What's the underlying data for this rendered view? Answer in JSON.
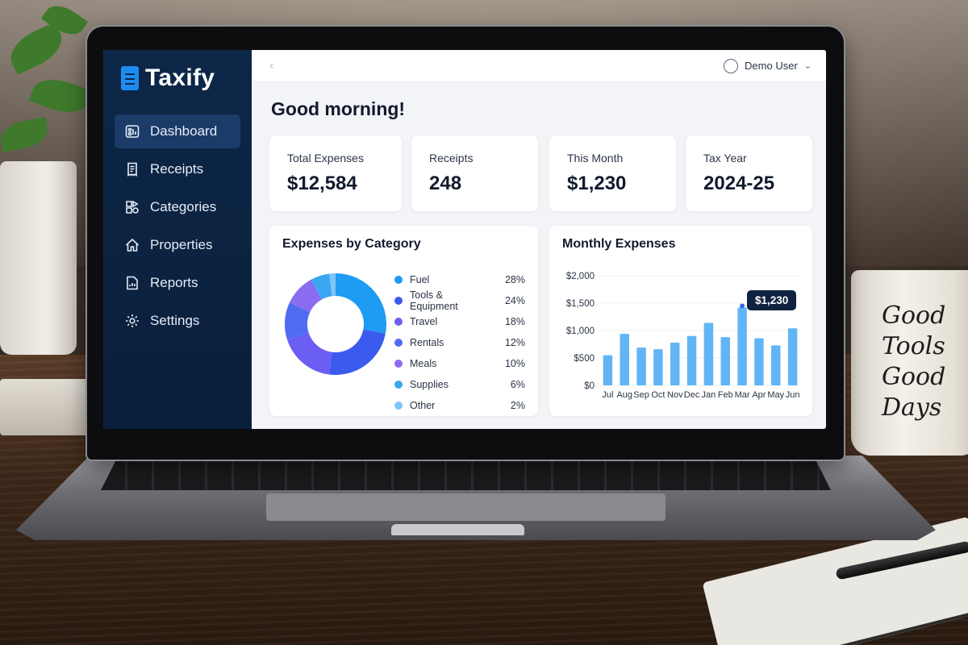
{
  "app": {
    "name": "Taxify"
  },
  "sidebar": {
    "items": [
      {
        "label": "Dashboard",
        "icon": "dashboard-icon",
        "active": true
      },
      {
        "label": "Receipts",
        "icon": "receipt-icon",
        "active": false
      },
      {
        "label": "Categories",
        "icon": "categories-icon",
        "active": false
      },
      {
        "label": "Properties",
        "icon": "home-icon",
        "active": false
      },
      {
        "label": "Reports",
        "icon": "report-icon",
        "active": false
      },
      {
        "label": "Settings",
        "icon": "gear-icon",
        "active": false
      }
    ]
  },
  "topbar": {
    "back_icon": "chevron-left-icon",
    "user_name": "Demo User",
    "user_icon": "user-icon",
    "dropdown_icon": "chevron-down-icon"
  },
  "main": {
    "greeting": "Good morning!",
    "stats": [
      {
        "label": "Total Expenses",
        "value": "$12,584"
      },
      {
        "label": "Receipts",
        "value": "248"
      },
      {
        "label": "This Month",
        "value": "$1,230"
      },
      {
        "label": "Tax Year",
        "value": "2024-25"
      }
    ]
  },
  "mug": {
    "text_lines": [
      "Good",
      "Tools",
      "Good",
      "Days"
    ]
  },
  "colors": {
    "sidebar_bg": "#0d2748",
    "sidebar_active": "#1b3c69",
    "brand_blue": "#1d8cf0",
    "bar_blue": "#62b5f5",
    "tooltip_bg": "#0f2240"
  },
  "chart_data": [
    {
      "type": "pie",
      "title": "Expenses by Category",
      "categories": [
        "Fuel",
        "Tools & Equipment",
        "Travel",
        "Rentals",
        "Meals",
        "Supplies",
        "Other"
      ],
      "values": [
        28,
        24,
        18,
        12,
        10,
        6,
        2
      ],
      "labels": [
        "28%",
        "24%",
        "18%",
        "12%",
        "10%",
        "6%",
        "2%"
      ],
      "colors": [
        "#1e9bf5",
        "#3b5bef",
        "#6a5ef3",
        "#4f6cf2",
        "#8a6cf0",
        "#3aa6f2",
        "#7fc4f6"
      ],
      "legend": "right"
    },
    {
      "type": "bar",
      "title": "Monthly Expenses",
      "categories": [
        "Jul",
        "Aug",
        "Sep",
        "Oct",
        "Nov",
        "Dec",
        "Jan",
        "Feb",
        "Mar",
        "Apr",
        "May",
        "Jun"
      ],
      "values": [
        550,
        940,
        690,
        660,
        780,
        900,
        1140,
        880,
        1420,
        860,
        730,
        1040
      ],
      "ylim": [
        0,
        2000
      ],
      "yticks": [
        "$0",
        "$500",
        "$1,000",
        "$1,500",
        "$2,000"
      ],
      "ytick_values": [
        0,
        500,
        1000,
        1500,
        2000
      ],
      "highlight": {
        "category": "Mar",
        "label": "$1,230"
      },
      "grid": true
    }
  ]
}
